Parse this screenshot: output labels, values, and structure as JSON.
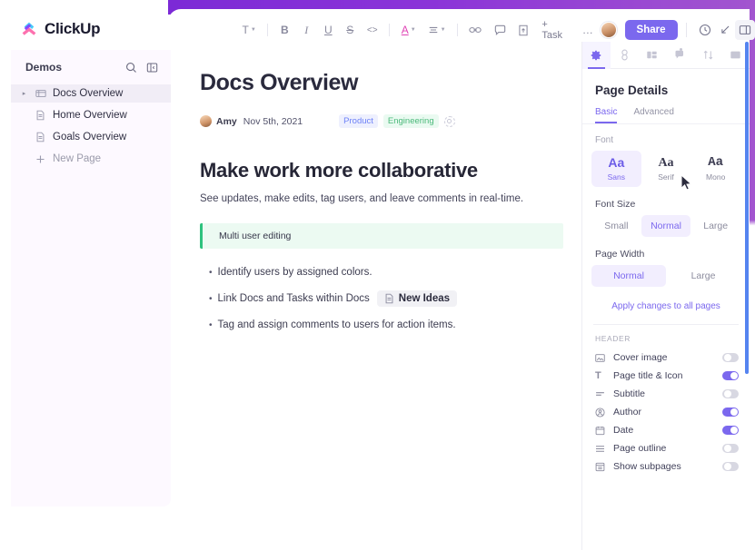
{
  "brand": {
    "name": "ClickUp",
    "accent": "#7b68ee",
    "banner_from": "#7c2ad6",
    "banner_to": "#a255cf"
  },
  "sidebar": {
    "title": "Demos",
    "search_icon": "search-icon",
    "collapse_icon": "collapse-panel-icon",
    "items": [
      {
        "label": "Docs Overview",
        "icon": "doc-stack-icon",
        "active": true,
        "caret": "▸"
      },
      {
        "label": "Home Overview",
        "icon": "doc-icon",
        "active": false,
        "caret": ""
      },
      {
        "label": "Goals Overview",
        "icon": "doc-icon",
        "active": false,
        "caret": ""
      },
      {
        "label": "New Page",
        "icon": "plus-icon",
        "active": false,
        "caret": ""
      }
    ]
  },
  "toolbar": {
    "text_style": "T",
    "bold": "B",
    "italic": "I",
    "underline": "U",
    "strike": "S",
    "code": "<>",
    "text_color": "A",
    "align": "align-icon",
    "link": "link-icon",
    "comment": "comment-icon",
    "attachment": "attachment-icon",
    "task_label": "+ Task",
    "more": "…",
    "share_label": "Share",
    "history_icon": "clock-history-icon",
    "download_icon": "download-icon",
    "panel_icon": "right-panel-icon",
    "avatar": "user-avatar"
  },
  "document": {
    "title": "Docs Overview",
    "author": "Amy",
    "date": "Nov 5th, 2021",
    "tags": [
      {
        "label": "Product",
        "color": "#6e82f7",
        "bg": "#eef0fe"
      },
      {
        "label": "Engineering",
        "color": "#4bb97a",
        "bg": "#eafaf1"
      }
    ],
    "add_tag_icon": "add-tag-icon",
    "heading": "Make work more collaborative",
    "subtitle": "See updates, make edits, tag users, and leave comments in real-time.",
    "callout": {
      "text": "Multi user editing",
      "bar_color": "#2ec27e",
      "bg": "#ecfaf2"
    },
    "bullets": [
      {
        "text": "Identify users by assigned colors.",
        "chip": null
      },
      {
        "text": "Link Docs and Tasks within Docs",
        "chip": "New Ideas"
      },
      {
        "text": "Tag and assign comments to users for action items.",
        "chip": null
      }
    ]
  },
  "panel": {
    "tabs": [
      {
        "icon": "gear-icon",
        "active": true,
        "badge": false
      },
      {
        "icon": "link-icon",
        "active": false,
        "badge": false
      },
      {
        "icon": "layout-icon",
        "active": false,
        "badge": false
      },
      {
        "icon": "comment-icon",
        "active": false,
        "badge": true
      },
      {
        "icon": "sort-icon",
        "active": false,
        "badge": false
      },
      {
        "icon": "image-icon",
        "active": false,
        "badge": false
      }
    ],
    "title": "Page Details",
    "subtabs": [
      {
        "label": "Basic",
        "active": true
      },
      {
        "label": "Advanced",
        "active": false
      }
    ],
    "font_label": "Font",
    "fonts": [
      {
        "sample": "Aa",
        "name": "Sans",
        "active": true
      },
      {
        "sample": "Aa",
        "name": "Serif",
        "active": false
      },
      {
        "sample": "Aa",
        "name": "Mono",
        "active": false
      }
    ],
    "font_size_label": "Font Size",
    "font_sizes": [
      {
        "label": "Small",
        "active": false
      },
      {
        "label": "Normal",
        "active": true
      },
      {
        "label": "Large",
        "active": false
      }
    ],
    "page_width_label": "Page Width",
    "page_widths": [
      {
        "label": "Normal",
        "active": true
      },
      {
        "label": "Large",
        "active": false
      }
    ],
    "apply_link": "Apply changes to all pages",
    "header_section_label": "HEADER",
    "toggles": [
      {
        "label": "Cover image",
        "icon": "image-icon",
        "on": false
      },
      {
        "label": "Page title & Icon",
        "icon": "text-t-icon",
        "on": true
      },
      {
        "label": "Subtitle",
        "icon": "subtitle-icon",
        "on": false
      },
      {
        "label": "Author",
        "icon": "author-icon",
        "on": true
      },
      {
        "label": "Date",
        "icon": "calendar-icon",
        "on": true
      },
      {
        "label": "Page outline",
        "icon": "outline-icon",
        "on": false
      },
      {
        "label": "Show subpages",
        "icon": "subpages-icon",
        "on": false
      }
    ]
  }
}
